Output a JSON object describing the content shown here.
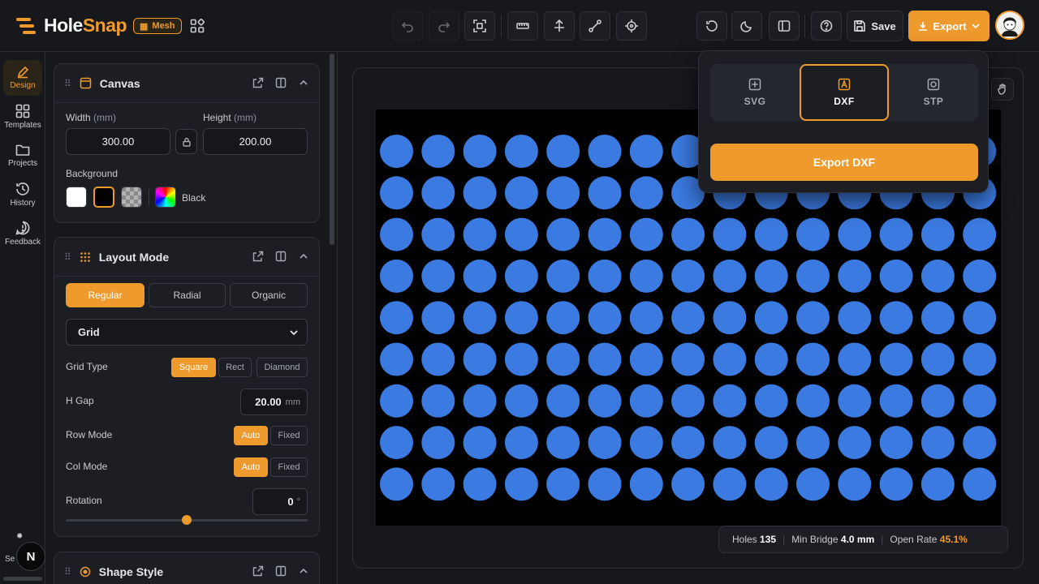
{
  "app": {
    "name_part1": "Hole",
    "name_part2": "Snap",
    "mode_badge": "Mesh"
  },
  "toolbar": {
    "save_label": "Save",
    "export_label": "Export"
  },
  "rail": {
    "items": [
      {
        "label": "Design",
        "icon": "pen-icon"
      },
      {
        "label": "Templates",
        "icon": "grid-icon"
      },
      {
        "label": "Projects",
        "icon": "folder-icon"
      },
      {
        "label": "History",
        "icon": "history-icon"
      },
      {
        "label": "Feedback",
        "icon": "feedback-icon"
      }
    ],
    "bottom_label": "Se",
    "user_initial": "N"
  },
  "canvas_panel": {
    "title": "Canvas",
    "width_label": "Width",
    "height_label": "Height",
    "unit": "(mm)",
    "width_value": "300.00",
    "height_value": "200.00",
    "background_label": "Background",
    "background_value": "Black"
  },
  "layout_panel": {
    "title": "Layout Mode",
    "modes": [
      "Regular",
      "Radial",
      "Organic"
    ],
    "active_mode": "Regular",
    "pattern": "Grid",
    "grid_type_label": "Grid Type",
    "grid_types": [
      "Square",
      "Rect",
      "Diamond"
    ],
    "active_grid_type": "Square",
    "hgap_label": "H Gap",
    "hgap_value": "20.00",
    "hgap_unit": "mm",
    "row_mode_label": "Row Mode",
    "col_mode_label": "Col Mode",
    "mode_options": [
      "Auto",
      "Fixed"
    ],
    "row_mode_active": "Auto",
    "col_mode_active": "Auto",
    "rotation_label": "Rotation",
    "rotation_value": "0",
    "rotation_unit": "°",
    "rotation_slider_fraction": 0.5
  },
  "shape_panel": {
    "title": "Shape Style"
  },
  "canvas_view": {
    "board_color": "#000000",
    "hole_color": "#3b7ae0",
    "rows": 9,
    "cols": 15
  },
  "stats": {
    "holes_label": "Holes",
    "holes_value": "135",
    "bridge_label": "Min Bridge",
    "bridge_value": "4.0 mm",
    "open_label": "Open Rate",
    "open_value": "45.1%"
  },
  "export_popover": {
    "formats": [
      "SVG",
      "DXF",
      "STP"
    ],
    "active_format": "DXF",
    "action_label": "Export DXF"
  },
  "colors": {
    "accent": "#ef9a2c",
    "bg": "#16181c",
    "card": "#1c1e23"
  }
}
